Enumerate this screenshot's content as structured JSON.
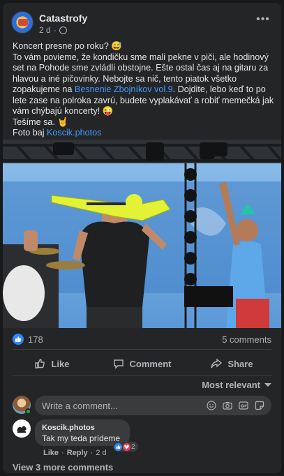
{
  "post": {
    "page_name": "Catastrofy",
    "time": "2 d",
    "privacy_icon": "globe-icon",
    "more_label": "•••",
    "text": {
      "line1": "Koncert presne po roku? 😅",
      "para_a": "To vám povieme, že kondičku sme mali pekne v piči, ale hodinový set na Pohode sme zvládli obstojne. Ešte ostal čas aj na gitaru za hlavou a iné pičovinky. Nebojte sa nič, tento piatok všetko zopakujeme na ",
      "link1": "Besnenie Zbojníkov vol.9",
      "para_b": ". Dojdite, lebo keď to po lete zase na polroka zavrú, budete vyplakávať a robiť memečká jak vám chýbajú koncerty! 😜",
      "line3": "Tešíme sa. 🤘",
      "photo_prefix": "Foto baj ",
      "link2": "Koscik.photos"
    }
  },
  "stats": {
    "likes": "178",
    "comments": "5 comments",
    "like_icon": "thumbs-up-icon"
  },
  "actions": {
    "like": "Like",
    "comment": "Comment",
    "share": "Share"
  },
  "sort": {
    "label": "Most relevant"
  },
  "composer": {
    "placeholder": "Write a comment...",
    "icons": [
      "smiley-icon",
      "camera-icon",
      "gif-icon",
      "sticker-icon"
    ]
  },
  "comments": [
    {
      "author": "Koscik.photos",
      "text": "Tak my teda prídeme",
      "reaction_count": "2",
      "like": "Like",
      "reply": "Reply",
      "sep": "·",
      "time": "2 d"
    }
  ],
  "view_more": "View 3 more comments",
  "colors": {
    "background": "#18191a",
    "card": "#242526",
    "link": "#4599ff",
    "like_blue": "#2d88ff"
  }
}
